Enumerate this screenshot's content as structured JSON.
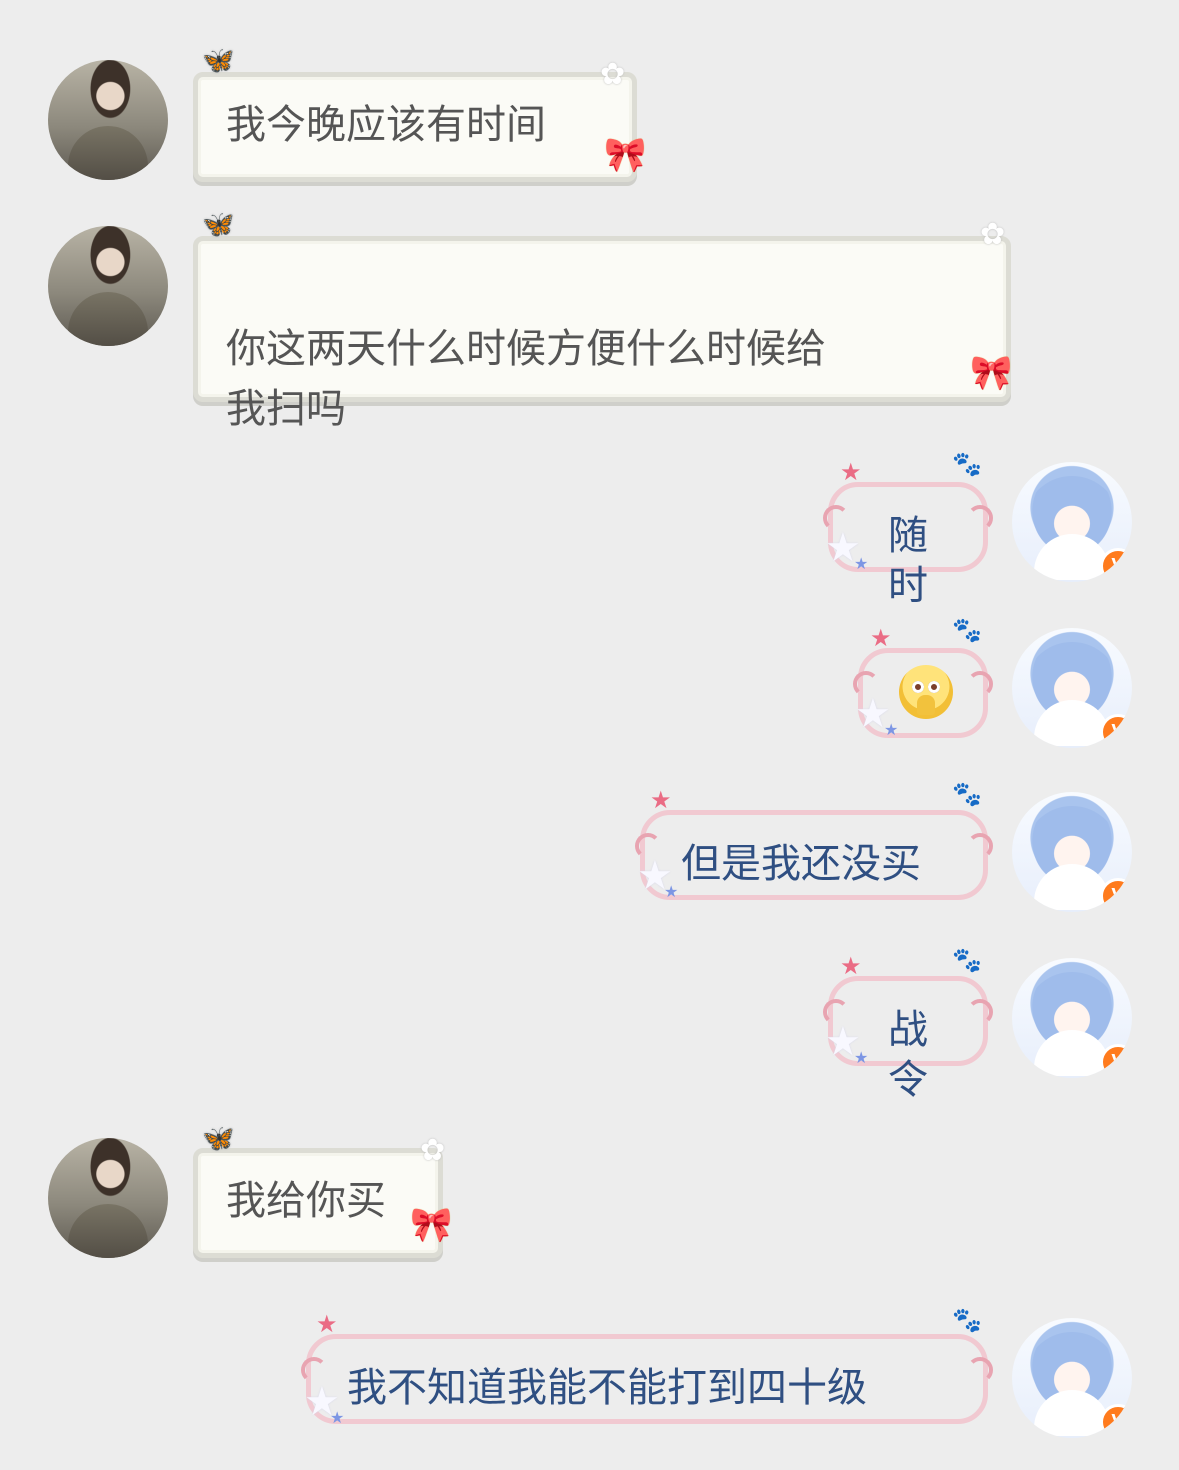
{
  "messages": [
    {
      "side": "left",
      "text": "我今晚应该有时间"
    },
    {
      "side": "left",
      "text": "你这两天什么时候方便什么时候给\n我扫吗"
    },
    {
      "side": "right",
      "text": "随时"
    },
    {
      "side": "right",
      "emoji": "pleading-face-with-hands"
    },
    {
      "side": "right",
      "text": "但是我还没买"
    },
    {
      "side": "right",
      "text": "战令"
    },
    {
      "side": "left",
      "text": "我给你买"
    },
    {
      "side": "right",
      "text": "我不知道我能不能打到四十级"
    }
  ],
  "avatar_badge": "V"
}
